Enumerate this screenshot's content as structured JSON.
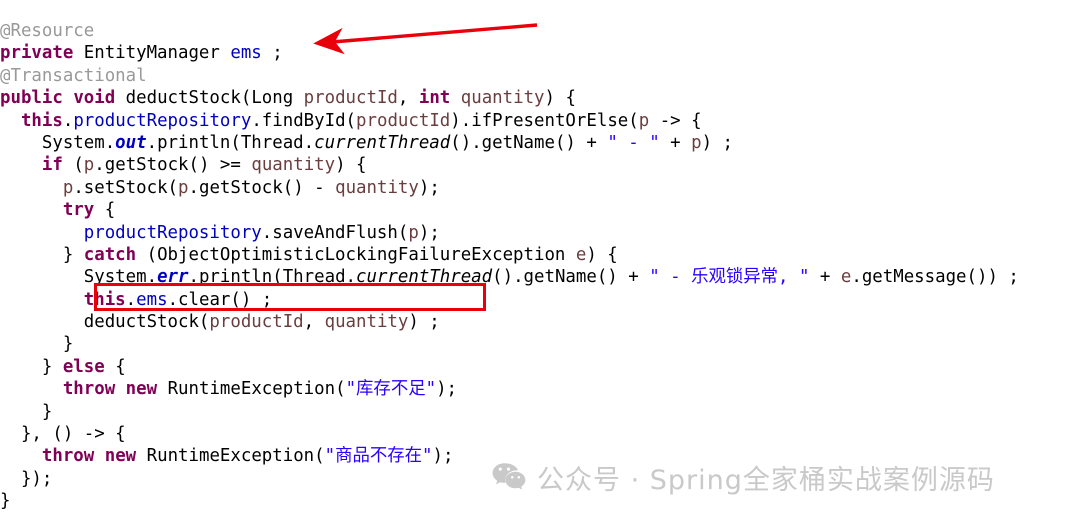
{
  "editor": {
    "language": "java",
    "lines": [
      [
        {
          "t": "ann",
          "s": "@Resource"
        }
      ],
      [
        {
          "t": "kw",
          "s": "private"
        },
        {
          "t": "plain",
          "s": " EntityManager "
        },
        {
          "t": "field",
          "s": "ems"
        },
        {
          "t": "plain",
          "s": " ;"
        }
      ],
      [
        {
          "t": "ann",
          "s": "@Transactional"
        }
      ],
      [
        {
          "t": "kw",
          "s": "public"
        },
        {
          "t": "plain",
          "s": " "
        },
        {
          "t": "kw",
          "s": "void"
        },
        {
          "t": "plain",
          "s": " deductStock(Long "
        },
        {
          "t": "param",
          "s": "productId"
        },
        {
          "t": "plain",
          "s": ", "
        },
        {
          "t": "kw",
          "s": "int"
        },
        {
          "t": "plain",
          "s": " "
        },
        {
          "t": "param",
          "s": "quantity"
        },
        {
          "t": "plain",
          "s": ") {"
        }
      ],
      [
        {
          "t": "plain",
          "s": "  "
        },
        {
          "t": "kw",
          "s": "this"
        },
        {
          "t": "plain",
          "s": "."
        },
        {
          "t": "field",
          "s": "productRepository"
        },
        {
          "t": "plain",
          "s": ".findById("
        },
        {
          "t": "param",
          "s": "productId"
        },
        {
          "t": "plain",
          "s": ").ifPresentOrElse("
        },
        {
          "t": "param",
          "s": "p"
        },
        {
          "t": "plain",
          "s": " -> {"
        }
      ],
      [
        {
          "t": "plain",
          "s": "    System."
        },
        {
          "t": "sfield",
          "s": "out"
        },
        {
          "t": "plain",
          "s": ".println(Thread."
        },
        {
          "t": "smeth",
          "s": "currentThread"
        },
        {
          "t": "plain",
          "s": "().getName() + "
        },
        {
          "t": "str",
          "s": "\" - \""
        },
        {
          "t": "plain",
          "s": " + "
        },
        {
          "t": "param",
          "s": "p"
        },
        {
          "t": "plain",
          "s": ") ;"
        }
      ],
      [
        {
          "t": "plain",
          "s": "    "
        },
        {
          "t": "kw",
          "s": "if"
        },
        {
          "t": "plain",
          "s": " ("
        },
        {
          "t": "param",
          "s": "p"
        },
        {
          "t": "plain",
          "s": ".getStock() >= "
        },
        {
          "t": "param",
          "s": "quantity"
        },
        {
          "t": "plain",
          "s": ") {"
        }
      ],
      [
        {
          "t": "plain",
          "s": "      "
        },
        {
          "t": "param",
          "s": "p"
        },
        {
          "t": "plain",
          "s": ".setStock("
        },
        {
          "t": "param",
          "s": "p"
        },
        {
          "t": "plain",
          "s": ".getStock() - "
        },
        {
          "t": "param",
          "s": "quantity"
        },
        {
          "t": "plain",
          "s": ");"
        }
      ],
      [
        {
          "t": "plain",
          "s": "      "
        },
        {
          "t": "kw",
          "s": "try"
        },
        {
          "t": "plain",
          "s": " {"
        }
      ],
      [
        {
          "t": "plain",
          "s": "        "
        },
        {
          "t": "field",
          "s": "productRepository"
        },
        {
          "t": "plain",
          "s": ".saveAndFlush("
        },
        {
          "t": "param",
          "s": "p"
        },
        {
          "t": "plain",
          "s": ");"
        }
      ],
      [
        {
          "t": "plain",
          "s": "      } "
        },
        {
          "t": "kw",
          "s": "catch"
        },
        {
          "t": "plain",
          "s": " (ObjectOptimisticLockingFailureException "
        },
        {
          "t": "param",
          "s": "e"
        },
        {
          "t": "plain",
          "s": ") {"
        }
      ],
      [
        {
          "t": "plain",
          "s": "        System."
        },
        {
          "t": "sfield",
          "s": "err"
        },
        {
          "t": "plain",
          "s": ".println(Thread."
        },
        {
          "t": "smeth",
          "s": "currentThread"
        },
        {
          "t": "plain",
          "s": "().getName() + "
        },
        {
          "t": "str",
          "s": "\" - 乐观锁异常, \""
        },
        {
          "t": "plain",
          "s": " + "
        },
        {
          "t": "param",
          "s": "e"
        },
        {
          "t": "plain",
          "s": ".getMessage()) ;"
        }
      ],
      [
        {
          "t": "plain",
          "s": "        "
        },
        {
          "t": "kw",
          "s": "this"
        },
        {
          "t": "plain",
          "s": "."
        },
        {
          "t": "field",
          "s": "ems"
        },
        {
          "t": "plain",
          "s": ".clear() ;"
        }
      ],
      [
        {
          "t": "plain",
          "s": "        deductStock("
        },
        {
          "t": "param",
          "s": "productId"
        },
        {
          "t": "plain",
          "s": ", "
        },
        {
          "t": "param",
          "s": "quantity"
        },
        {
          "t": "plain",
          "s": ") ;"
        }
      ],
      [
        {
          "t": "plain",
          "s": "      }"
        }
      ],
      [
        {
          "t": "plain",
          "s": "    } "
        },
        {
          "t": "kw",
          "s": "else"
        },
        {
          "t": "plain",
          "s": " {"
        }
      ],
      [
        {
          "t": "plain",
          "s": "      "
        },
        {
          "t": "kw",
          "s": "throw"
        },
        {
          "t": "plain",
          "s": " "
        },
        {
          "t": "kw",
          "s": "new"
        },
        {
          "t": "plain",
          "s": " RuntimeException("
        },
        {
          "t": "str",
          "s": "\"库存不足\""
        },
        {
          "t": "plain",
          "s": ");"
        }
      ],
      [
        {
          "t": "plain",
          "s": "    }"
        }
      ],
      [
        {
          "t": "plain",
          "s": "  }, () -> {"
        }
      ],
      [
        {
          "t": "plain",
          "s": "    "
        },
        {
          "t": "kw",
          "s": "throw"
        },
        {
          "t": "plain",
          "s": " "
        },
        {
          "t": "kw",
          "s": "new"
        },
        {
          "t": "plain",
          "s": " RuntimeException("
        },
        {
          "t": "str",
          "s": "\"商品不存在\""
        },
        {
          "t": "plain",
          "s": ");"
        }
      ],
      [
        {
          "t": "plain",
          "s": "  });"
        }
      ],
      [
        {
          "t": "plain",
          "s": "}"
        }
      ]
    ],
    "plain_text": "@Resource\nprivate EntityManager ems ;\n@Transactional\npublic void deductStock(Long productId, int quantity) {\n  this.productRepository.findById(productId).ifPresentOrElse(p -> {\n    System.out.println(Thread.currentThread().getName() + \" - \" + p) ;\n    if (p.getStock() >= quantity) {\n      p.setStock(p.getStock() - quantity);\n      try {\n        productRepository.saveAndFlush(p);\n      } catch (ObjectOptimisticLockingFailureException e) {\n        System.err.println(Thread.currentThread().getName() + \" - 乐观锁异常, \" + e.getMessage()) ;\n        this.ems.clear() ;\n        deductStock(productId, quantity) ;\n      }\n    } else {\n      throw new RuntimeException(\"库存不足\");\n    }\n  }, () -> {\n    throw new RuntimeException(\"商品不存在\");\n  });\n}"
  },
  "annotations": {
    "highlight_box": {
      "target_text": "this.ems.clear() ;",
      "color": "#e8000b"
    },
    "arrow": {
      "target_text": "private EntityManager ems ;",
      "direction": "points-left",
      "color": "#e8000b"
    }
  },
  "watermark": {
    "icon": "wechat-logo-icon",
    "text": "公众号 · Spring全家桶实战案例源码",
    "color": "#c9c9c9"
  },
  "theme": {
    "background": "#ffffff",
    "keyword": "#7f0055",
    "field": "#0000c0",
    "string": "#2a00ff",
    "parameter": "#6a3e3e",
    "annotation": "#999999",
    "plain": "#000000",
    "accent_red": "#e8000b"
  }
}
